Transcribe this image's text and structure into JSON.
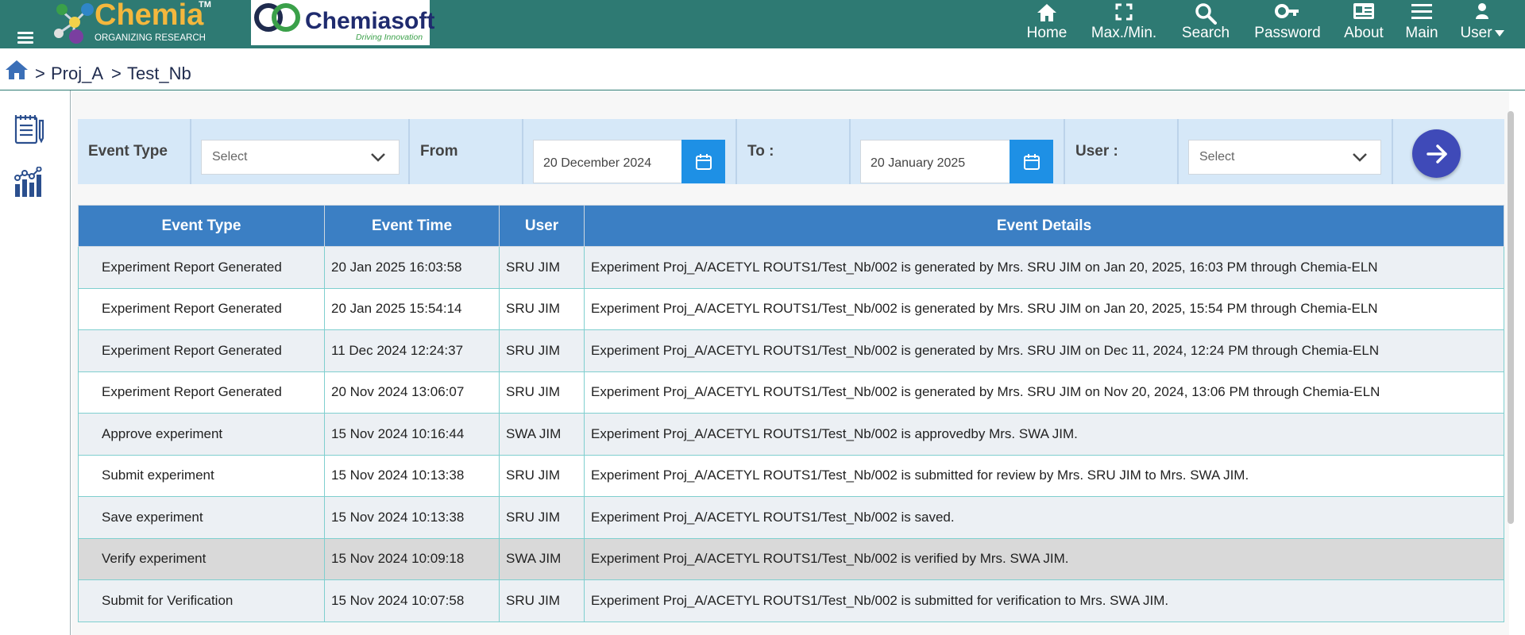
{
  "header": {
    "chemia_word": "Chemia",
    "chemia_tm": "TM",
    "chemia_sub": "ORGANIZING RESEARCH",
    "at": "@",
    "chemiasoft_word": "Chemiasoft",
    "chemiasoft_sub": "Driving Innovation",
    "nav": [
      {
        "label": "Home",
        "icon": "home-icon"
      },
      {
        "label": "Max./Min.",
        "icon": "fullscreen-icon"
      },
      {
        "label": "Search",
        "icon": "search-icon"
      },
      {
        "label": "Password",
        "icon": "key-icon"
      },
      {
        "label": "About",
        "icon": "id-card-icon"
      },
      {
        "label": "Main",
        "icon": "menu-icon"
      },
      {
        "label": "User",
        "icon": "user-icon"
      }
    ]
  },
  "breadcrumb": {
    "sep1": ">",
    "item1": "Proj_A",
    "sep2": ">",
    "item2": "Test_Nb"
  },
  "sidebar": {
    "items": [
      {
        "icon": "notebook-icon"
      },
      {
        "icon": "chart-icon"
      }
    ]
  },
  "filter": {
    "event_type_label": "Event Type",
    "event_type_value": "Select",
    "from_label": "From",
    "from_value": "20 December 2024",
    "to_label": "To :",
    "to_value": "20 January 2025",
    "user_label": "User :",
    "user_value": "Select"
  },
  "table": {
    "headers": [
      "Event Type",
      "Event Time",
      "User",
      "Event Details"
    ],
    "rows": [
      [
        "Experiment Report Generated",
        "20 Jan 2025 16:03:58",
        "SRU JIM",
        "Experiment Proj_A/ACETYL ROUTS1/Test_Nb/002 is generated by Mrs. SRU JIM on Jan 20, 2025, 16:03 PM through Chemia-ELN"
      ],
      [
        "Experiment Report Generated",
        "20 Jan 2025 15:54:14",
        "SRU JIM",
        "Experiment Proj_A/ACETYL ROUTS1/Test_Nb/002 is generated by Mrs. SRU JIM on Jan 20, 2025, 15:54 PM through Chemia-ELN"
      ],
      [
        "Experiment Report Generated",
        "11 Dec 2024 12:24:37",
        "SRU JIM",
        "Experiment Proj_A/ACETYL ROUTS1/Test_Nb/002 is generated by Mrs. SRU JIM on Dec 11, 2024, 12:24 PM through Chemia-ELN"
      ],
      [
        "Experiment Report Generated",
        "20 Nov 2024 13:06:07",
        "SRU JIM",
        "Experiment Proj_A/ACETYL ROUTS1/Test_Nb/002 is generated by Mrs. SRU JIM on Nov 20, 2024, 13:06 PM through Chemia-ELN"
      ],
      [
        "Approve experiment",
        "15 Nov 2024 10:16:44",
        "SWA JIM",
        "Experiment Proj_A/ACETYL ROUTS1/Test_Nb/002 is approvedby Mrs. SWA JIM."
      ],
      [
        "Submit experiment",
        "15 Nov 2024 10:13:38",
        "SRU JIM",
        "Experiment Proj_A/ACETYL ROUTS1/Test_Nb/002 is submitted for review by Mrs. SRU JIM to Mrs. SWA JIM."
      ],
      [
        "Save experiment",
        "15 Nov 2024 10:13:38",
        "SRU JIM",
        "Experiment Proj_A/ACETYL ROUTS1/Test_Nb/002 is saved."
      ],
      [
        "Verify experiment",
        "15 Nov 2024 10:09:18",
        "SWA JIM",
        "Experiment Proj_A/ACETYL ROUTS1/Test_Nb/002 is verified by Mrs. SWA JIM."
      ],
      [
        "Submit for Verification",
        "15 Nov 2024 10:07:58",
        "SRU JIM",
        "Experiment Proj_A/ACETYL ROUTS1/Test_Nb/002 is submitted for verification to Mrs. SWA JIM."
      ]
    ]
  },
  "colors": {
    "topbar": "#2e7a73",
    "table_header": "#3b7fc4",
    "filter_bg": "#d6e8f8",
    "calendar_button": "#1e90e5",
    "go_button": "#3f4ab8",
    "row_highlight": "#d9d9d9"
  }
}
